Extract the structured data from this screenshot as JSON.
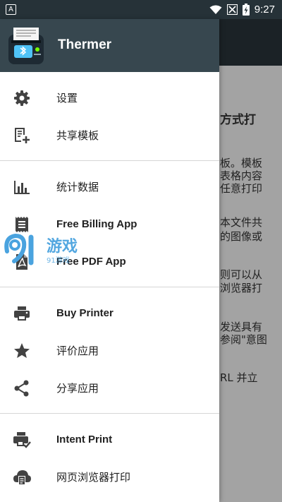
{
  "status_bar": {
    "time": "9:27",
    "notification_letter": "A"
  },
  "background": {
    "heading": "方式打",
    "lines": [
      "板。模板",
      "表格内容",
      "任意打印",
      "本文件共",
      "的图像或",
      "则可以从",
      "浏览器打",
      "发送具有",
      "参阅\"意图",
      "RL 并立"
    ]
  },
  "drawer": {
    "app_name": "Thermer",
    "items": [
      {
        "label": "设置",
        "icon": "gear-icon"
      },
      {
        "label": "共享模板",
        "icon": "share-template-icon"
      },
      {
        "label": "统计数据",
        "icon": "bar-chart-icon"
      },
      {
        "label": "Free Billing App",
        "icon": "receipt-icon"
      },
      {
        "label": "Free PDF App",
        "icon": "pdf-icon"
      },
      {
        "label": "Buy Printer",
        "icon": "printer-icon"
      },
      {
        "label": "评价应用",
        "icon": "star-icon"
      },
      {
        "label": "分享应用",
        "icon": "share-icon"
      },
      {
        "label": "Intent Print",
        "icon": "printer-check-icon"
      },
      {
        "label": "网页浏览器打印",
        "icon": "cloud-document-icon"
      }
    ]
  },
  "watermark": {
    "text": "91游戏"
  },
  "colors": {
    "status_bar": "#263238",
    "header": "#37474f",
    "icon": "#424242",
    "scrim": "#9e9e9e"
  }
}
